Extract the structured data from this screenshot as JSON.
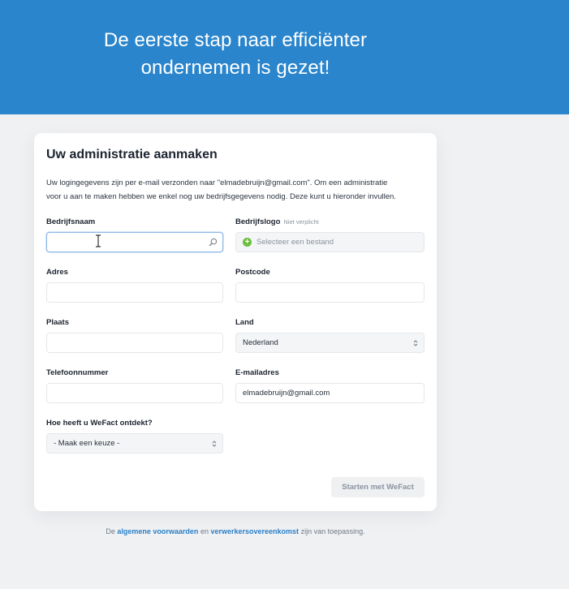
{
  "hero": {
    "line1": "De eerste stap naar efficiënter",
    "line2": "ondernemen is gezet!"
  },
  "card": {
    "title": "Uw administratie aanmaken",
    "intro_line1": "Uw logingegevens zijn per e-mail verzonden naar \"elmadebruijn@gmail.com\". Om een administratie",
    "intro_line2": "voor u aan te maken hebben we enkel nog uw bedrijfsgegevens nodig. Deze kunt u hieronder invullen."
  },
  "fields": {
    "bedrijfsnaam": {
      "label": "Bedrijfsnaam",
      "value": ""
    },
    "bedrijfslogo": {
      "label": "Bedrijfslogo",
      "hint": "Niet verplicht",
      "placeholder": "Selecteer een bestand"
    },
    "adres": {
      "label": "Adres",
      "value": ""
    },
    "postcode": {
      "label": "Postcode",
      "value": ""
    },
    "plaats": {
      "label": "Plaats",
      "value": ""
    },
    "land": {
      "label": "Land",
      "value": "Nederland"
    },
    "telefoonnummer": {
      "label": "Telefoonnummer",
      "value": ""
    },
    "emailadres": {
      "label": "E-mailadres",
      "value": "elmadebruijn@gmail.com"
    },
    "wefact_ontdekt": {
      "label": "Hoe heeft u WeFact ontdekt?",
      "value": "- Maak een keuze -"
    }
  },
  "actions": {
    "submit_label": "Starten met WeFact"
  },
  "footer": {
    "prefix": "De",
    "link1": "algemene voorwaarden",
    "middle": "en",
    "link2": "verwerkersovereenkomst",
    "suffix": "zijn van toepassing."
  },
  "colors": {
    "hero_background": "#2a85cc",
    "page_background": "#f0f1f3",
    "link": "#2a7fc8",
    "upload_plus": "#6cbf3c"
  },
  "icons": [
    "search-icon",
    "plus-circle-icon",
    "select-arrows-icon",
    "text-cursor-icon"
  ]
}
